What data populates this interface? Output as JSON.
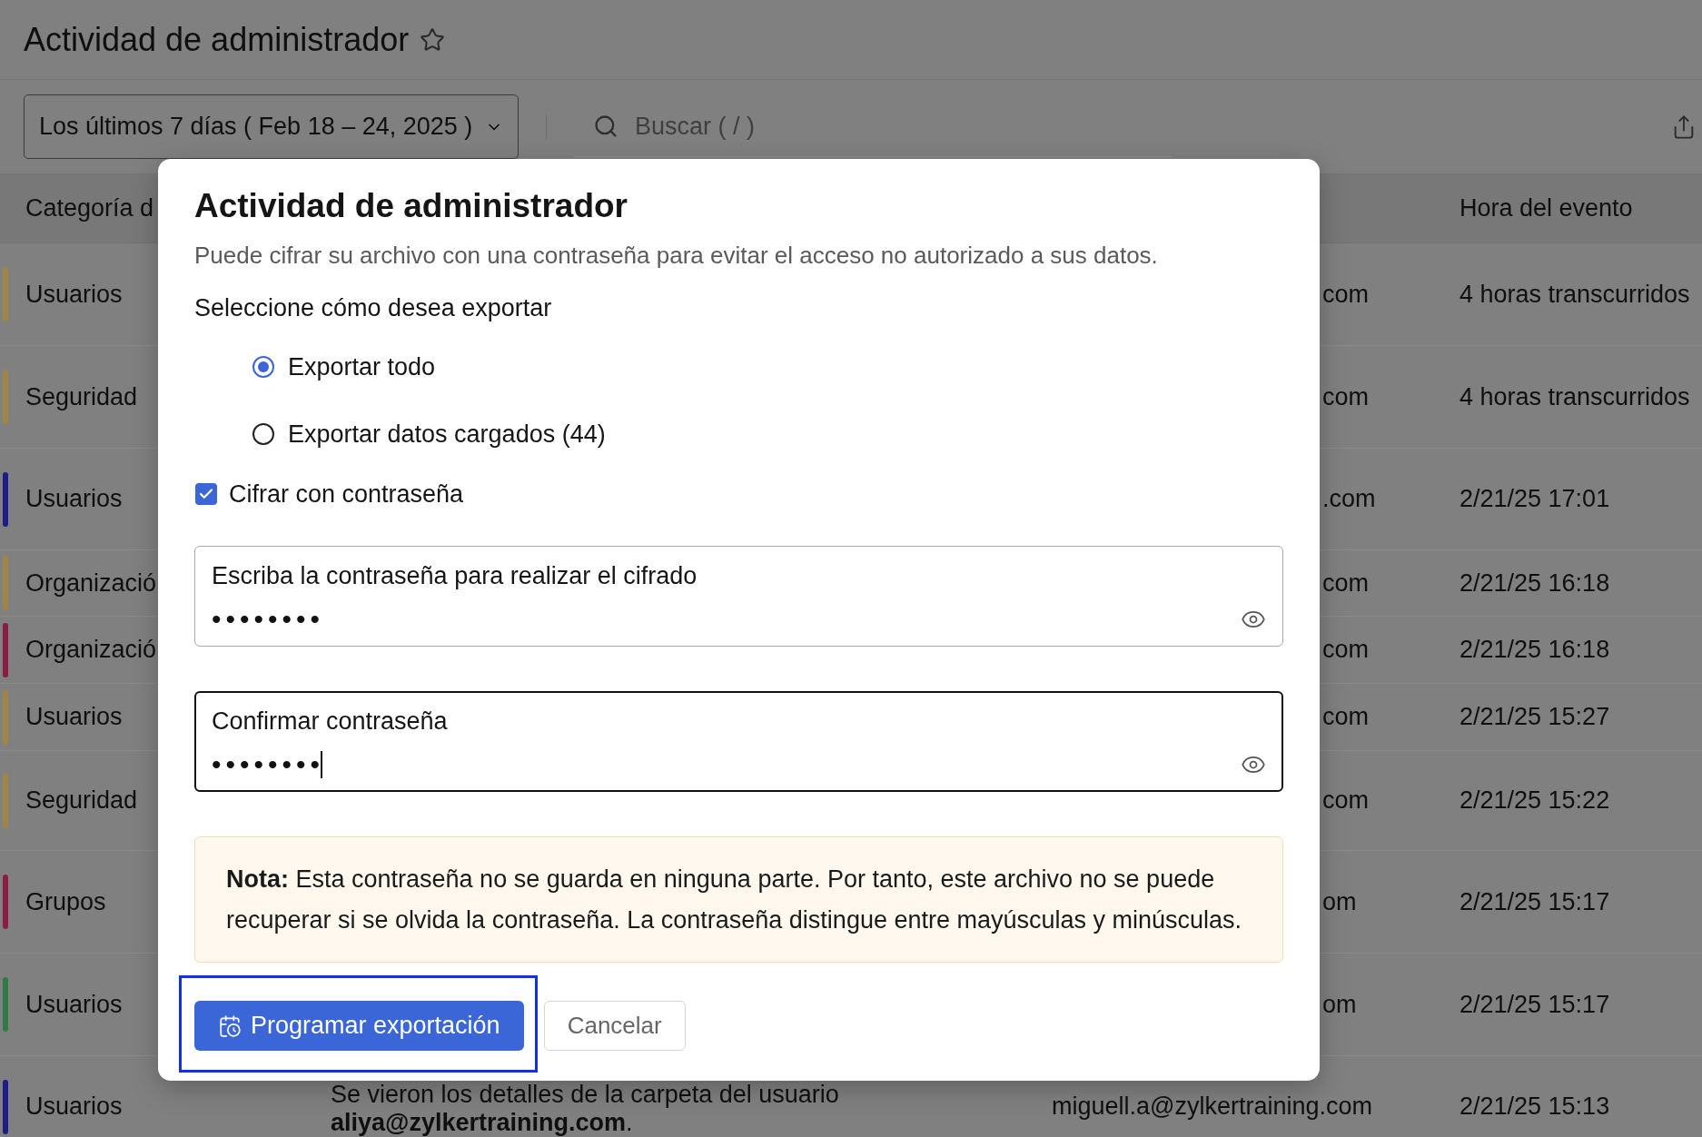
{
  "page": {
    "title": "Actividad de administrador",
    "starred": false
  },
  "toolbar": {
    "date_range": "Los últimos 7 días ( Feb 18 – 24, 2025 )",
    "search": {
      "placeholder": "Buscar ( / )"
    }
  },
  "table": {
    "columns": {
      "category": "Categoría d",
      "time": "Hora del evento"
    },
    "rows": [
      {
        "category": "Usuarios",
        "color": "#a08443",
        "column_3": {
          "text": "com",
          "cut": true
        },
        "time": "4 horas transcurridos"
      },
      {
        "category": "Seguridad",
        "color": "#a08443",
        "column_3": {
          "text": "com",
          "cut": true
        },
        "time": "4 horas transcurridos"
      },
      {
        "category": "Usuarios",
        "color": "#1c1c8a",
        "column_3": {
          "text": ".com",
          "cut": true
        },
        "time": "2/21/25 17:01"
      },
      {
        "category": "Organizació",
        "color": "#a08443",
        "column_3": {
          "text": "com",
          "cut": true
        },
        "time": "2/21/25 16:18"
      },
      {
        "category": "Organizació",
        "color": "#8c1c44",
        "column_3": {
          "text": "com",
          "cut": true
        },
        "time": "2/21/25 16:18"
      },
      {
        "category": "Usuarios",
        "color": "#a08443",
        "column_3": {
          "text": "com",
          "cut": true
        },
        "time": "2/21/25 15:27"
      },
      {
        "category": "Seguridad",
        "color": "#a08443",
        "column_3": {
          "text": "com",
          "cut": true
        },
        "time": "2/21/25 15:22"
      },
      {
        "category": "Grupos",
        "color": "#8c1c44",
        "column_3": {
          "text": "om",
          "cut": true
        },
        "time": "2/21/25 15:17"
      },
      {
        "category": "Usuarios",
        "color": "#2f7a45",
        "column_3": {
          "text": "om",
          "cut": true
        },
        "time": "2/21/25 15:17"
      },
      {
        "category": "Usuarios",
        "color": "#1c1c8a",
        "column_2": "Se vieron los detalles de la carpeta del usuario **aliya@zylkertraining.com**.",
        "column_3": {
          "text": "miguell.a@zylkertraining.com",
          "cut": false
        },
        "time": "2/21/25 15:13"
      }
    ]
  },
  "dialog": {
    "title": "Actividad de administrador",
    "description": "Puede cifrar su archivo con una contraseña para evitar el acceso no autorizado a sus datos.",
    "prompt": "Seleccione cómo desea exportar",
    "options": [
      {
        "label": "Exportar todo",
        "selected": true
      },
      {
        "label": "Exportar datos cargados (44)",
        "selected": false
      }
    ],
    "encrypt": {
      "label": "Cifrar con contraseña",
      "checked": true
    },
    "fields": [
      {
        "label": "Escriba la contraseña para realizar el cifrado",
        "value": "••••••••",
        "focused": false
      },
      {
        "label": "Confirmar contraseña",
        "value": "••••••••",
        "focused": true
      }
    ],
    "note": "**Nota:** Esta contraseña no se guarda en ninguna parte. Por tanto, este archivo no se puede recuperar si se olvida la contraseña. La contraseña distingue entre mayúsculas y minúsculas.",
    "buttons": [
      {
        "label": "Programar exportación",
        "kind": "primary",
        "highlighted": true
      },
      {
        "label": "Cancelar",
        "kind": "secondary",
        "highlighted": false
      }
    ]
  }
}
